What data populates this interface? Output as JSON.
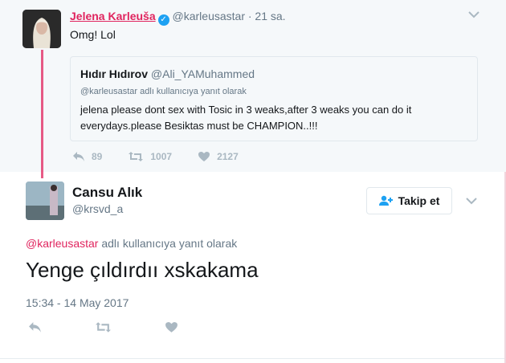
{
  "parent_tweet": {
    "display_name": "Jelena Karleuša",
    "handle": "@karleusastar",
    "time": "· 21 sa.",
    "text": "Omg! Lol",
    "quoted": {
      "display_name": "Hıdır Hıdırov",
      "handle": "@Ali_YAMuhammed",
      "reply_context": "@karleusastar adlı kullanıcıya yanıt olarak",
      "text": "jelena please dont sex with Tosic in 3 weaks,after 3 weaks you can do it everydays.please Besiktas must be CHAMPION..!!!"
    },
    "stats": {
      "replies": "89",
      "retweets": "1007",
      "likes": "2127"
    }
  },
  "reply_tweet": {
    "display_name": "Cansu Alık",
    "handle": "@krsvd_a",
    "follow_label": "Takip et",
    "reply_mention": "@karleusastar",
    "reply_suffix": " adlı kullanıcıya yanıt olarak",
    "text": "Yenge çıldırdıı xskakama",
    "timestamp": "15:34 - 14 May 2017"
  },
  "colors": {
    "accent_pink": "#e0245e",
    "verified_blue": "#1da1f2",
    "muted": "#657786",
    "icon_gray": "#aab8c2"
  }
}
